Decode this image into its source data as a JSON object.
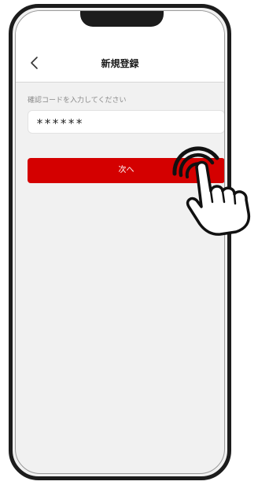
{
  "header": {
    "title": "新規登録",
    "back_icon": "chevron-left-icon"
  },
  "form": {
    "instruction": "確認コードを入力してください",
    "code_value": "******"
  },
  "actions": {
    "next_label": "次へ"
  },
  "colors": {
    "accent": "#d40000",
    "background": "#f1f1f1",
    "frame": "#1c1c1c"
  },
  "overlay": {
    "icon": "tap-gesture-hand-icon"
  }
}
